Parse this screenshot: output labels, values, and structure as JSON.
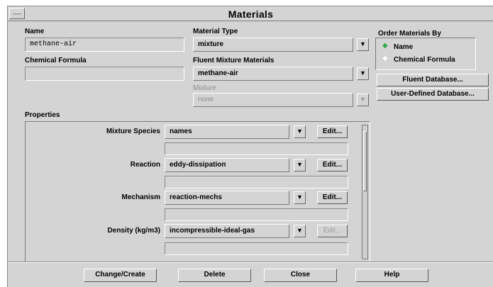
{
  "window": {
    "title": "Materials"
  },
  "name": {
    "label": "Name",
    "value": "methane-air"
  },
  "chemical_formula": {
    "label": "Chemical Formula",
    "value": ""
  },
  "material_type": {
    "label": "Material Type",
    "value": "mixture"
  },
  "fluent_mixture_materials": {
    "label": "Fluent Mixture Materials",
    "value": "methane-air"
  },
  "mixture": {
    "label": "Mixture",
    "value": "none"
  },
  "order_by": {
    "label": "Order Materials By",
    "options": [
      {
        "label": "Name",
        "selected": true
      },
      {
        "label": "Chemical Formula",
        "selected": false
      }
    ]
  },
  "database_buttons": {
    "fluent": "Fluent Database...",
    "user": "User-Defined Database..."
  },
  "properties": {
    "label": "Properties",
    "rows": [
      {
        "label": "Mixture Species",
        "value": "names",
        "edit": "Edit...",
        "edit_enabled": true
      },
      {
        "label": "Reaction",
        "value": "eddy-dissipation",
        "edit": "Edit...",
        "edit_enabled": true
      },
      {
        "label": "Mechanism",
        "value": "reaction-mechs",
        "edit": "Edit...",
        "edit_enabled": true
      },
      {
        "label": "Density (kg/m3)",
        "value": "incompressible-ideal-gas",
        "edit": "Edit...",
        "edit_enabled": false
      }
    ]
  },
  "actions": {
    "change_create": "Change/Create",
    "delete": "Delete",
    "close": "Close",
    "help": "Help"
  },
  "icons": {
    "dropdown": "▼",
    "system_menu": "system-menu-icon"
  }
}
